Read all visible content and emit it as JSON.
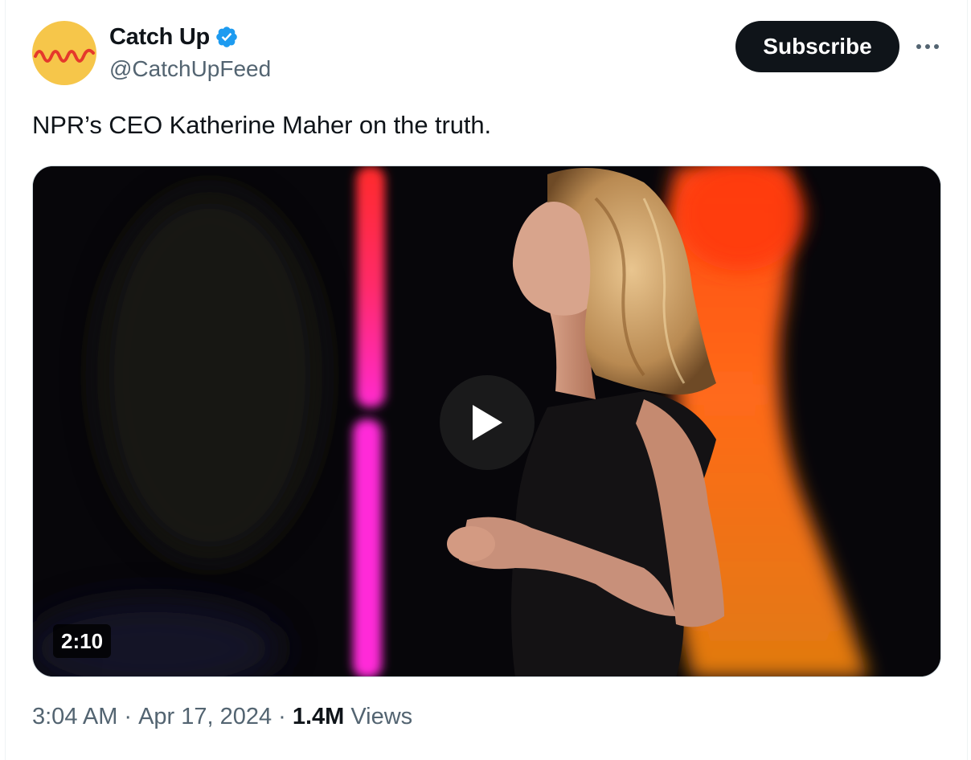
{
  "author": {
    "display_name": "Catch Up",
    "handle": "@CatchUpFeed",
    "verified": true,
    "avatar_icon": "waveform-logo-icon",
    "avatar_bg_color": "#f6c64a",
    "avatar_wave_color": "#e5392b"
  },
  "actions": {
    "subscribe_label": "Subscribe",
    "more_icon": "more-horizontal-icon"
  },
  "tweet": {
    "text": "NPR’s CEO Katherine Maher on the truth."
  },
  "media": {
    "type": "video",
    "duration": "2:10",
    "play_icon": "play-icon"
  },
  "meta": {
    "time": "3:04 AM",
    "separator": "·",
    "date": "Apr 17, 2024",
    "views_count": "1.4M",
    "views_label": "Views"
  },
  "colors": {
    "text_primary": "#0f1419",
    "text_secondary": "#536471",
    "verified_blue": "#1d9bf0",
    "button_dark": "#0f1419"
  }
}
